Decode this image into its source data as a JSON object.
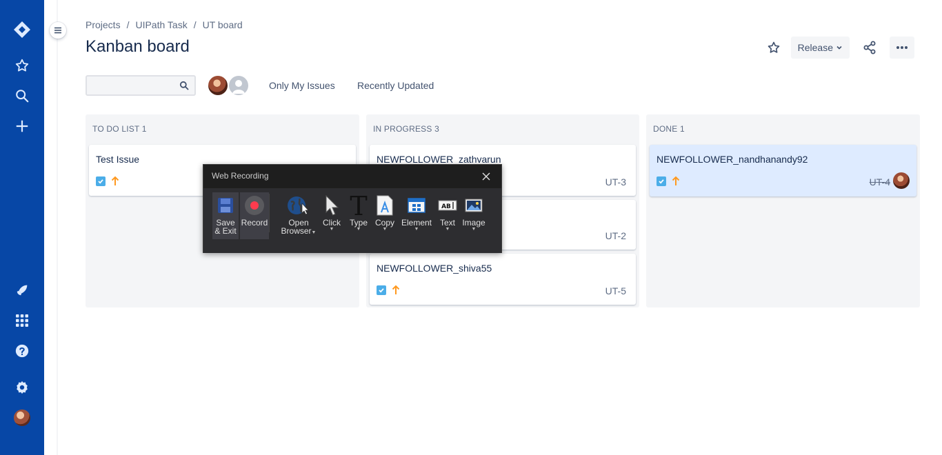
{
  "breadcrumb": {
    "projects": "Projects",
    "sep1": "/",
    "project": "UIPath Task",
    "sep2": "/",
    "board": "UT board"
  },
  "page": {
    "title": "Kanban board"
  },
  "header": {
    "release_label": "Release"
  },
  "search": {
    "placeholder": ""
  },
  "filters": {
    "only_my_issues": "Only My Issues",
    "recently_updated": "Recently Updated"
  },
  "columns": [
    {
      "title": "TO DO LIST",
      "count": "1",
      "cards": [
        {
          "title": "Test Issue",
          "key": ""
        }
      ]
    },
    {
      "title": "IN PROGRESS",
      "count": "3",
      "cards": [
        {
          "title": "NEWFOLLOWER_zathvarun",
          "key": "UT-3"
        },
        {
          "title": "",
          "key": "UT-2"
        },
        {
          "title": "NEWFOLLOWER_shiva55",
          "key": "UT-5"
        }
      ]
    },
    {
      "title": "DONE",
      "count": "1",
      "cards": [
        {
          "title": "NEWFOLLOWER_nandhanandy92",
          "key": "UT-4"
        }
      ]
    }
  ],
  "recorder": {
    "title": "Web Recording",
    "buttons": {
      "save_line1": "Save",
      "save_line2": "& Exit",
      "record": "Record",
      "open_line1": "Open",
      "open_line2": "Browser",
      "click": "Click",
      "type": "Type",
      "copy": "Copy",
      "element": "Element",
      "text": "Text",
      "image": "Image"
    }
  },
  "colors": {
    "nav": "#0747a6",
    "column_bg": "#f4f5f7",
    "done_card": "#deebff",
    "priority": "#ff991f",
    "record": "#ff3b4e"
  }
}
